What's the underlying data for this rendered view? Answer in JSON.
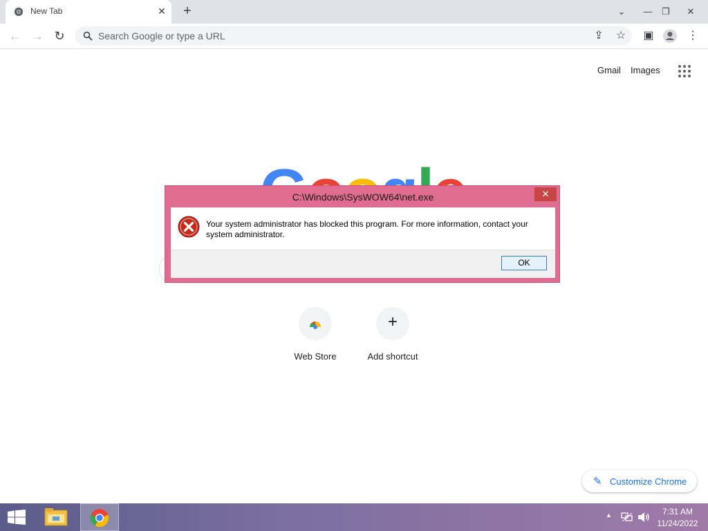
{
  "browser": {
    "tab_title": "New Tab",
    "tab_close_glyph": "✕",
    "new_tab_glyph": "+",
    "omnibox_placeholder": "Search Google or type a URL"
  },
  "ntp": {
    "gmail": "Gmail",
    "images": "Images",
    "logo_letters": [
      "G",
      "o",
      "o",
      "g",
      "l",
      "e"
    ],
    "logo_colors": [
      "#4285f4",
      "#ea4335",
      "#fbbc05",
      "#4285f4",
      "#34a853",
      "#ea4335"
    ],
    "shortcuts": [
      {
        "label": "Web Store",
        "icon": "webstore-icon"
      },
      {
        "label": "Add shortcut",
        "icon": "plus-icon"
      }
    ],
    "customize_label": "Customize Chrome"
  },
  "dialog": {
    "title": "C:\\Windows\\SysWOW64\\net.exe",
    "message": "Your system administrator has blocked this program. For more information, contact your system administrator.",
    "ok_label": "OK",
    "close_glyph": "✕"
  },
  "taskbar": {
    "time": "7:31 AM",
    "date": "11/24/2022"
  },
  "colors": {
    "accent": "#1a73e8",
    "dialog_frame": "#e06c92",
    "error_red": "#c42b1c"
  }
}
